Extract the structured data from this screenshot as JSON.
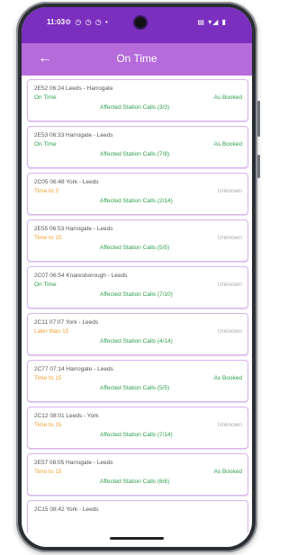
{
  "status_bar": {
    "time": "11:03",
    "left_icons": "⚙ ◷ ◷ ◷ •",
    "right_icons": "▤ ▾◢ ▮"
  },
  "app_bar": {
    "back_icon": "back-arrow-icon",
    "title": "On Time"
  },
  "colors": {
    "status_bar": "#7b2fbf",
    "app_bar": "#b56bd9",
    "card_border": "#d8b3ec",
    "green": "#2e9f4a",
    "orange": "#f0a030",
    "grey": "#a8a8a8"
  },
  "services": [
    {
      "title": "2E52 06:24 Leeds - Harrogate",
      "status": "On Time",
      "status_color": "green",
      "booking": "As Booked",
      "booking_color": "green",
      "affected": "Affected Station Calls (3/3)"
    },
    {
      "title": "2E53 06:33 Harrogate - Leeds",
      "status": "On Time",
      "status_color": "green",
      "booking": "As Booked",
      "booking_color": "green",
      "affected": "Affected Station Calls (7/8)"
    },
    {
      "title": "2C05 06:48 York - Leeds",
      "status": "Time to 3",
      "status_color": "orange",
      "booking": "Unknown",
      "booking_color": "grey",
      "affected": "Affected Station Calls (2/14)"
    },
    {
      "title": "2E55 06:53 Harrogate - Leeds",
      "status": "Time to 15",
      "status_color": "orange",
      "booking": "Unknown",
      "booking_color": "grey",
      "affected": "Affected Station Calls (5/5)"
    },
    {
      "title": "2C07 06:54 Knaresborough - Leeds",
      "status": "On Time",
      "status_color": "green",
      "booking": "Unknown",
      "booking_color": "grey",
      "affected": "Affected Station Calls (7/10)"
    },
    {
      "title": "2C11 07:07 York - Leeds",
      "status": "Later than 15",
      "status_color": "orange",
      "booking": "Unknown",
      "booking_color": "grey",
      "affected": "Affected Station Calls (4/14)"
    },
    {
      "title": "2C77 07:14 Harrogate - Leeds",
      "status": "Time to 15",
      "status_color": "orange",
      "booking": "As Booked",
      "booking_color": "green",
      "affected": "Affected Station Calls (5/5)"
    },
    {
      "title": "2C12 08:01 Leeds - York",
      "status": "Time to 15",
      "status_color": "orange",
      "booking": "Unknown",
      "booking_color": "grey",
      "affected": "Affected Station Calls (7/14)"
    },
    {
      "title": "2E57 08:05 Harrogate - Leeds",
      "status": "Time to 15",
      "status_color": "orange",
      "booking": "As Booked",
      "booking_color": "green",
      "affected": "Affected Station Calls (6/6)"
    },
    {
      "title": "2C15 08:42 York - Leeds",
      "status": "",
      "status_color": "green",
      "booking": "",
      "booking_color": "grey",
      "affected": ""
    }
  ]
}
